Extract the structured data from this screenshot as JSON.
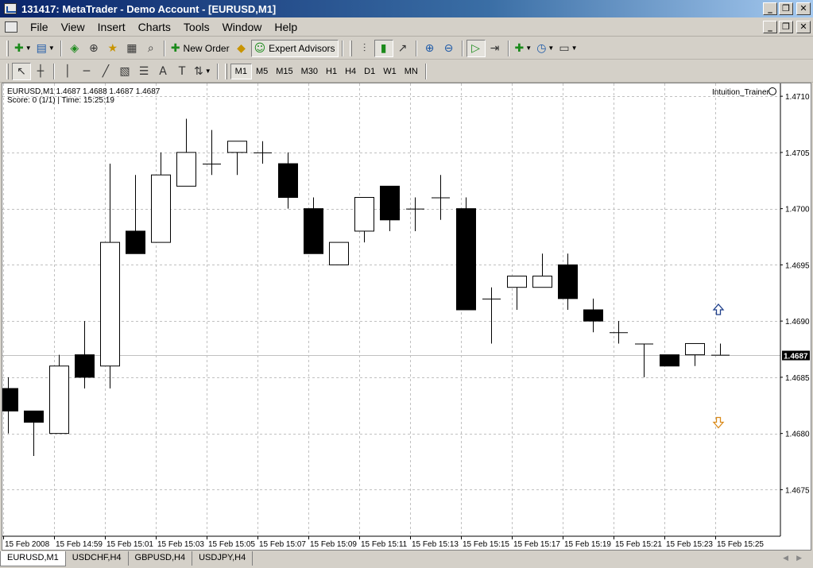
{
  "window": {
    "title": "131417: MetaTrader - Demo Account - [EURUSD,M1]",
    "minimize": "_",
    "restore": "❐",
    "close": "✕"
  },
  "menu": [
    "File",
    "View",
    "Insert",
    "Charts",
    "Tools",
    "Window",
    "Help"
  ],
  "toolbar": {
    "new_order": "New Order",
    "expert_advisors": "Expert Advisors"
  },
  "timeframes": [
    "M1",
    "M5",
    "M15",
    "M30",
    "H1",
    "H4",
    "D1",
    "W1",
    "MN"
  ],
  "active_timeframe": "M1",
  "chart": {
    "info_line": "EURUSD,M1  1.4687 1.4688 1.4687 1.4687",
    "score_line": "Score: 0 (1/1)  |  Time: 15:25:19",
    "indicator_name": "Intuition_Trainer",
    "current_price": "1.4687"
  },
  "tabs": [
    "EURUSD,M1",
    "USDCHF,H4",
    "GBPUSD,H4",
    "USDJPY,H4"
  ],
  "active_tab": "EURUSD,M1",
  "chart_data": {
    "type": "candlestick",
    "symbol": "EURUSD",
    "timeframe": "M1",
    "ylim": [
      1.4671,
      1.4711
    ],
    "y_ticks": [
      "1.4710",
      "1.4705",
      "1.4700",
      "1.4695",
      "1.4690",
      "1.4685",
      "1.4680",
      "1.4675"
    ],
    "x_ticks": [
      "15 Feb 2008",
      "15 Feb 14:59",
      "15 Feb 15:01",
      "15 Feb 15:03",
      "15 Feb 15:05",
      "15 Feb 15:07",
      "15 Feb 15:09",
      "15 Feb 15:11",
      "15 Feb 15:13",
      "15 Feb 15:15",
      "15 Feb 15:17",
      "15 Feb 15:19",
      "15 Feb 15:21",
      "15 Feb 15:23",
      "15 Feb 15:25"
    ],
    "candles": [
      {
        "open": 1.4684,
        "high": 1.4685,
        "low": 1.468,
        "close": 1.4682
      },
      {
        "open": 1.4682,
        "high": 1.4682,
        "low": 1.4678,
        "close": 1.4681
      },
      {
        "open": 1.468,
        "high": 1.4687,
        "low": 1.468,
        "close": 1.4686
      },
      {
        "open": 1.4687,
        "high": 1.469,
        "low": 1.4684,
        "close": 1.4685
      },
      {
        "open": 1.4686,
        "high": 1.4704,
        "low": 1.4684,
        "close": 1.4697
      },
      {
        "open": 1.4698,
        "high": 1.4703,
        "low": 1.4696,
        "close": 1.4696
      },
      {
        "open": 1.4697,
        "high": 1.4705,
        "low": 1.4697,
        "close": 1.4703
      },
      {
        "open": 1.4702,
        "high": 1.4708,
        "low": 1.4702,
        "close": 1.4705
      },
      {
        "open": 1.4704,
        "high": 1.4707,
        "low": 1.4703,
        "close": 1.4704
      },
      {
        "open": 1.4705,
        "high": 1.4706,
        "low": 1.4703,
        "close": 1.4706
      },
      {
        "open": 1.4705,
        "high": 1.4706,
        "low": 1.4704,
        "close": 1.4705
      },
      {
        "open": 1.4704,
        "high": 1.4705,
        "low": 1.47,
        "close": 1.4701
      },
      {
        "open": 1.47,
        "high": 1.4701,
        "low": 1.4696,
        "close": 1.4696
      },
      {
        "open": 1.4695,
        "high": 1.4697,
        "low": 1.4695,
        "close": 1.4697
      },
      {
        "open": 1.4698,
        "high": 1.4701,
        "low": 1.4697,
        "close": 1.4701
      },
      {
        "open": 1.4702,
        "high": 1.4702,
        "low": 1.4698,
        "close": 1.4699
      },
      {
        "open": 1.47,
        "high": 1.4701,
        "low": 1.4698,
        "close": 1.47
      },
      {
        "open": 1.4701,
        "high": 1.4703,
        "low": 1.4699,
        "close": 1.4701
      },
      {
        "open": 1.47,
        "high": 1.4701,
        "low": 1.4691,
        "close": 1.4691
      },
      {
        "open": 1.4692,
        "high": 1.4693,
        "low": 1.4688,
        "close": 1.4692
      },
      {
        "open": 1.4693,
        "high": 1.4694,
        "low": 1.4691,
        "close": 1.4694
      },
      {
        "open": 1.4693,
        "high": 1.4696,
        "low": 1.4693,
        "close": 1.4694
      },
      {
        "open": 1.4695,
        "high": 1.4696,
        "low": 1.4691,
        "close": 1.4692
      },
      {
        "open": 1.4691,
        "high": 1.4692,
        "low": 1.4689,
        "close": 1.469
      },
      {
        "open": 1.4689,
        "high": 1.469,
        "low": 1.4688,
        "close": 1.4689
      },
      {
        "open": 1.4688,
        "high": 1.4688,
        "low": 1.4685,
        "close": 1.4688
      },
      {
        "open": 1.4687,
        "high": 1.4687,
        "low": 1.4686,
        "close": 1.4686
      },
      {
        "open": 1.4687,
        "high": 1.4688,
        "low": 1.4686,
        "close": 1.4688
      },
      {
        "open": 1.4687,
        "high": 1.4688,
        "low": 1.4687,
        "close": 1.4687
      }
    ],
    "arrows": [
      {
        "candle": 28,
        "direction": "up",
        "price": 1.4691,
        "color": "#1e3f8a"
      },
      {
        "candle": 28,
        "direction": "down",
        "price": 1.4681,
        "color": "#d98a1a"
      }
    ],
    "bid_line": 1.4687,
    "grid": true,
    "colors": {
      "bull_body": "#ffffff",
      "bear_body": "#000000",
      "outline": "#000000",
      "grid": "#c0c0c0",
      "bid_line": "#c0c0c0"
    }
  }
}
